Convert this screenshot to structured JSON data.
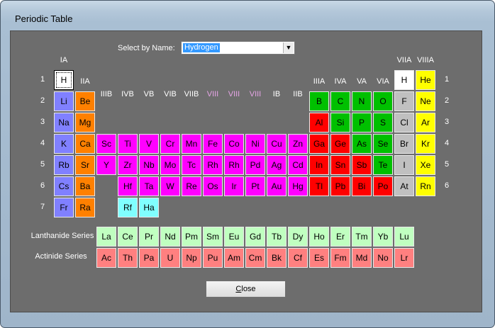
{
  "window": {
    "title": "Periodic Table"
  },
  "selector": {
    "label": "Select  by Name:",
    "value": "Hydrogen"
  },
  "group_labels": {
    "IA": "IA",
    "IIA": "IIA",
    "IIIB": "IIIB",
    "IVB": "IVB",
    "VB": "VB",
    "VIB": "VIB",
    "VIIB": "VIIB",
    "VIII_1": "VIII",
    "VIII_2": "VIII",
    "VIII_3": "VIII",
    "IB": "IB",
    "IIB": "IIB",
    "IIIA": "IIIA",
    "IVA": "IVA",
    "VA": "VA",
    "VIA": "VIA",
    "VIIA": "VIIA",
    "VIIIA": "VIIIA"
  },
  "period_numbers": [
    "1",
    "2",
    "3",
    "4",
    "5",
    "6",
    "7"
  ],
  "series_labels": {
    "lanthanide": "Lanthanide Series",
    "actinide": "Actinide Series"
  },
  "colors": {
    "alkali": "#8080ff",
    "alkaline": "#ff8000",
    "transition": "#ff00ff",
    "post": "#ff0000",
    "nonmetal": "#00c000",
    "metalloid": "#c0c0c0",
    "halogen_gas": "#ffffff",
    "noble": "#ffff00",
    "actinoid_row7": "#80ffff",
    "lanthanide": "#c0ffc0",
    "actinide": "#ff8080"
  },
  "elements": [
    {
      "s": "H",
      "r": 1,
      "c": 1,
      "t": "halogen_gas",
      "sel": true
    },
    {
      "s": "H",
      "r": 1,
      "c": 17,
      "t": "halogen_gas"
    },
    {
      "s": "He",
      "r": 1,
      "c": 18,
      "t": "noble"
    },
    {
      "s": "Li",
      "r": 2,
      "c": 1,
      "t": "alkali"
    },
    {
      "s": "Be",
      "r": 2,
      "c": 2,
      "t": "alkaline"
    },
    {
      "s": "B",
      "r": 2,
      "c": 13,
      "t": "nonmetal"
    },
    {
      "s": "C",
      "r": 2,
      "c": 14,
      "t": "nonmetal"
    },
    {
      "s": "N",
      "r": 2,
      "c": 15,
      "t": "nonmetal"
    },
    {
      "s": "O",
      "r": 2,
      "c": 16,
      "t": "nonmetal"
    },
    {
      "s": "F",
      "r": 2,
      "c": 17,
      "t": "metalloid"
    },
    {
      "s": "Ne",
      "r": 2,
      "c": 18,
      "t": "noble"
    },
    {
      "s": "Na",
      "r": 3,
      "c": 1,
      "t": "alkali"
    },
    {
      "s": "Mg",
      "r": 3,
      "c": 2,
      "t": "alkaline"
    },
    {
      "s": "Al",
      "r": 3,
      "c": 13,
      "t": "post"
    },
    {
      "s": "Si",
      "r": 3,
      "c": 14,
      "t": "nonmetal"
    },
    {
      "s": "P",
      "r": 3,
      "c": 15,
      "t": "nonmetal"
    },
    {
      "s": "S",
      "r": 3,
      "c": 16,
      "t": "nonmetal"
    },
    {
      "s": "Cl",
      "r": 3,
      "c": 17,
      "t": "metalloid"
    },
    {
      "s": "Ar",
      "r": 3,
      "c": 18,
      "t": "noble"
    },
    {
      "s": "K",
      "r": 4,
      "c": 1,
      "t": "alkali"
    },
    {
      "s": "Ca",
      "r": 4,
      "c": 2,
      "t": "alkaline"
    },
    {
      "s": "Sc",
      "r": 4,
      "c": 3,
      "t": "transition"
    },
    {
      "s": "Ti",
      "r": 4,
      "c": 4,
      "t": "transition"
    },
    {
      "s": "V",
      "r": 4,
      "c": 5,
      "t": "transition"
    },
    {
      "s": "Cr",
      "r": 4,
      "c": 6,
      "t": "transition"
    },
    {
      "s": "Mn",
      "r": 4,
      "c": 7,
      "t": "transition"
    },
    {
      "s": "Fe",
      "r": 4,
      "c": 8,
      "t": "transition"
    },
    {
      "s": "Co",
      "r": 4,
      "c": 9,
      "t": "transition"
    },
    {
      "s": "Ni",
      "r": 4,
      "c": 10,
      "t": "transition"
    },
    {
      "s": "Cu",
      "r": 4,
      "c": 11,
      "t": "transition"
    },
    {
      "s": "Zn",
      "r": 4,
      "c": 12,
      "t": "transition"
    },
    {
      "s": "Ga",
      "r": 4,
      "c": 13,
      "t": "post"
    },
    {
      "s": "Ge",
      "r": 4,
      "c": 14,
      "t": "post"
    },
    {
      "s": "As",
      "r": 4,
      "c": 15,
      "t": "nonmetal"
    },
    {
      "s": "Se",
      "r": 4,
      "c": 16,
      "t": "nonmetal"
    },
    {
      "s": "Br",
      "r": 4,
      "c": 17,
      "t": "metalloid"
    },
    {
      "s": "Kr",
      "r": 4,
      "c": 18,
      "t": "noble"
    },
    {
      "s": "Rb",
      "r": 5,
      "c": 1,
      "t": "alkali"
    },
    {
      "s": "Sr",
      "r": 5,
      "c": 2,
      "t": "alkaline"
    },
    {
      "s": "Y",
      "r": 5,
      "c": 3,
      "t": "transition"
    },
    {
      "s": "Zr",
      "r": 5,
      "c": 4,
      "t": "transition"
    },
    {
      "s": "Nb",
      "r": 5,
      "c": 5,
      "t": "transition"
    },
    {
      "s": "Mo",
      "r": 5,
      "c": 6,
      "t": "transition"
    },
    {
      "s": "Tc",
      "r": 5,
      "c": 7,
      "t": "transition"
    },
    {
      "s": "Rh",
      "r": 5,
      "c": 8,
      "t": "transition"
    },
    {
      "s": "Rh",
      "r": 5,
      "c": 9,
      "t": "transition"
    },
    {
      "s": "Pd",
      "r": 5,
      "c": 10,
      "t": "transition"
    },
    {
      "s": "Ag",
      "r": 5,
      "c": 11,
      "t": "transition"
    },
    {
      "s": "Cd",
      "r": 5,
      "c": 12,
      "t": "transition"
    },
    {
      "s": "In",
      "r": 5,
      "c": 13,
      "t": "post"
    },
    {
      "s": "Sn",
      "r": 5,
      "c": 14,
      "t": "post"
    },
    {
      "s": "Sb",
      "r": 5,
      "c": 15,
      "t": "post"
    },
    {
      "s": "Te",
      "r": 5,
      "c": 16,
      "t": "nonmetal"
    },
    {
      "s": "I",
      "r": 5,
      "c": 17,
      "t": "metalloid"
    },
    {
      "s": "Xe",
      "r": 5,
      "c": 18,
      "t": "noble"
    },
    {
      "s": "Cs",
      "r": 6,
      "c": 1,
      "t": "alkali"
    },
    {
      "s": "Ba",
      "r": 6,
      "c": 2,
      "t": "alkaline"
    },
    {
      "s": "Hf",
      "r": 6,
      "c": 4,
      "t": "transition"
    },
    {
      "s": "Ta",
      "r": 6,
      "c": 5,
      "t": "transition"
    },
    {
      "s": "W",
      "r": 6,
      "c": 6,
      "t": "transition"
    },
    {
      "s": "Re",
      "r": 6,
      "c": 7,
      "t": "transition"
    },
    {
      "s": "Os",
      "r": 6,
      "c": 8,
      "t": "transition"
    },
    {
      "s": "Ir",
      "r": 6,
      "c": 9,
      "t": "transition"
    },
    {
      "s": "Pt",
      "r": 6,
      "c": 10,
      "t": "transition"
    },
    {
      "s": "Au",
      "r": 6,
      "c": 11,
      "t": "transition"
    },
    {
      "s": "Hg",
      "r": 6,
      "c": 12,
      "t": "transition"
    },
    {
      "s": "Tl",
      "r": 6,
      "c": 13,
      "t": "post"
    },
    {
      "s": "Pb",
      "r": 6,
      "c": 14,
      "t": "post"
    },
    {
      "s": "Bi",
      "r": 6,
      "c": 15,
      "t": "post"
    },
    {
      "s": "Po",
      "r": 6,
      "c": 16,
      "t": "post"
    },
    {
      "s": "At",
      "r": 6,
      "c": 17,
      "t": "metalloid"
    },
    {
      "s": "Rn",
      "r": 6,
      "c": 18,
      "t": "noble"
    },
    {
      "s": "Fr",
      "r": 7,
      "c": 1,
      "t": "alkali"
    },
    {
      "s": "Ra",
      "r": 7,
      "c": 2,
      "t": "alkaline"
    },
    {
      "s": "Rf",
      "r": 7,
      "c": 4,
      "t": "actinoid_row7"
    },
    {
      "s": "Ha",
      "r": 7,
      "c": 5,
      "t": "actinoid_row7"
    }
  ],
  "lanthanides": [
    "La",
    "Ce",
    "Pr",
    "Nd",
    "Pm",
    "Sm",
    "Eu",
    "Gd",
    "Tb",
    "Dy",
    "Ho",
    "Er",
    "Tm",
    "Yb",
    "Lu"
  ],
  "actinides": [
    "Ac",
    "Th",
    "Pa",
    "U",
    "Np",
    "Pu",
    "Am",
    "Cm",
    "Bk",
    "Cf",
    "Es",
    "Fm",
    "Md",
    "No",
    "Lr"
  ],
  "close_button": {
    "label_accel": "C",
    "label_rest": "lose"
  }
}
